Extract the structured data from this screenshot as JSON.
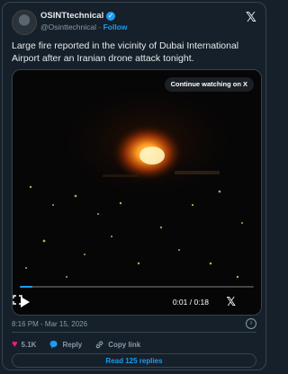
{
  "author": {
    "name": "OSINTtechnical",
    "handle": "@Osinttechnical",
    "separator": "·",
    "follow_label": "Follow"
  },
  "tweet": {
    "text": "Large fire reported in the vicinity of Dubai International Airport after an Iranian drone attack tonight."
  },
  "video": {
    "continue_label": "Continue watching on X",
    "time": "0:01 / 0:18",
    "progress": 0.055
  },
  "meta": {
    "timestamp": "8:16 PM - Mar 15, 2026"
  },
  "actions": {
    "likes": "5.1K",
    "reply_label": "Reply",
    "copy_label": "Copy link",
    "read_replies_label": "Read 125 replies"
  },
  "colors": {
    "background": "#15202b",
    "accent": "#1d9bf0",
    "like": "#f91880"
  }
}
